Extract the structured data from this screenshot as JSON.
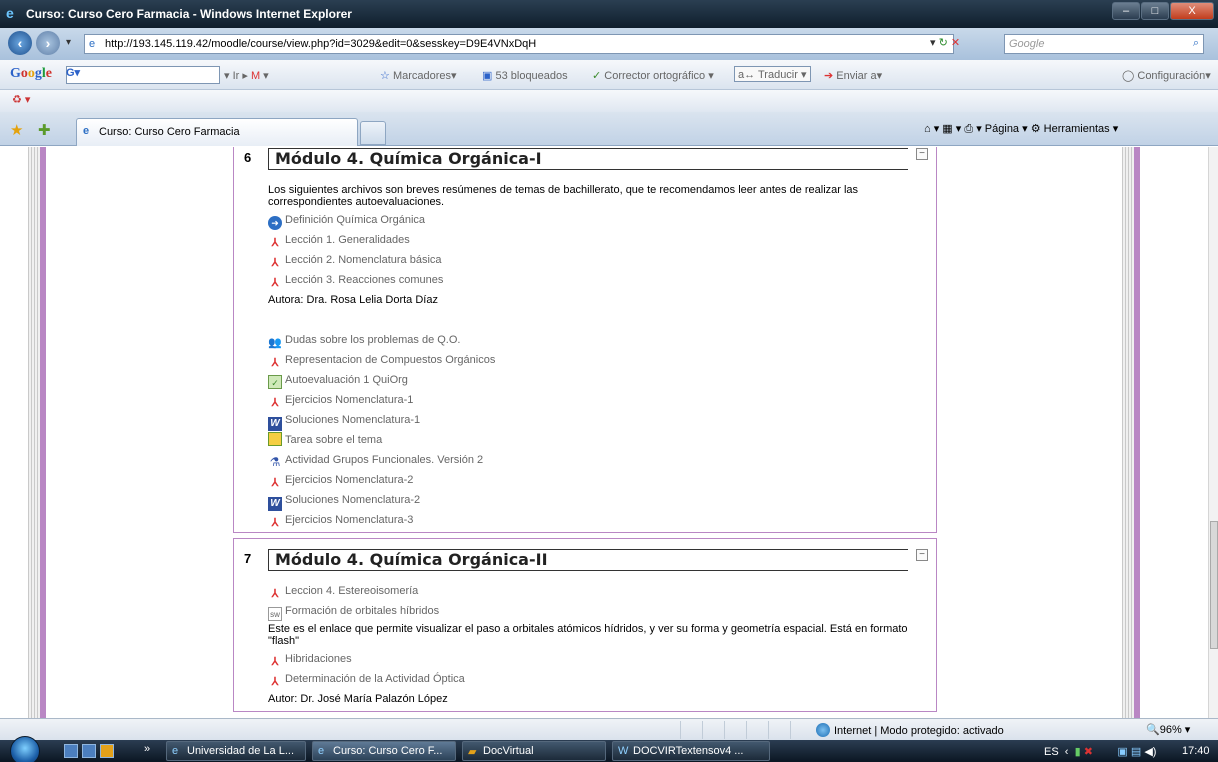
{
  "window": {
    "title": "Curso: Curso Cero Farmacia - Windows Internet Explorer",
    "controls": [
      "–",
      "□",
      "X"
    ]
  },
  "address": {
    "url": "http://193.145.119.42/moodle/course/view.php?id=3029&edit=0&sesskey=D9E4VNxDqH",
    "search_placeholder": "Google"
  },
  "google_toolbar": {
    "logo": [
      "G",
      "o",
      "o",
      "g",
      "l",
      "e"
    ],
    "search_prefix": "G▾",
    "go_label": "Ir",
    "bookmarks": "Marcadores▾",
    "blocked": "53 bloqueados",
    "spellcheck": "Corrector ortográfico ▾",
    "translate": "Traducir",
    "send": "Enviar a▾",
    "settings": "Configuración▾"
  },
  "tabs": {
    "active_tab": "Curso: Curso Cero Farmacia",
    "command_bar": "▾  ▾  ▾ Página ▾  Herramientas ▾",
    "page_label": "Página ▾",
    "tools_label": "Herramientas ▾"
  },
  "section6": {
    "number": "6",
    "title": "Módulo 4. Química Orgánica-I",
    "collapse": "−",
    "intro": "Los siguientes archivos son breves resúmenes de temas de bachillerato, que te recomendamos leer antes de realizar las correspondientes autoevaluaciones.",
    "items": [
      {
        "icon": "link",
        "label": "Definición Química Orgánica"
      },
      {
        "icon": "pdf",
        "label": "Lección 1. Generalidades"
      },
      {
        "icon": "pdf",
        "label": "Lección 2. Nomenclatura básica"
      },
      {
        "icon": "pdf",
        "label": "Lección 3. Reacciones comunes"
      }
    ],
    "author": "Autora: Dra. Rosa Lelia Dorta Díaz",
    "items2": [
      {
        "icon": "forum",
        "label": "Dudas sobre los problemas de Q.O."
      },
      {
        "icon": "pdf",
        "label": "Representacion de Compuestos Orgánicos"
      },
      {
        "icon": "quiz",
        "label": "Autoevaluación 1 QuiOrg"
      },
      {
        "icon": "pdf",
        "label": "Ejercicios Nomenclatura-1"
      },
      {
        "icon": "word",
        "label": "Soluciones Nomenclatura-1"
      },
      {
        "icon": "task",
        "label": "Tarea sobre el tema"
      },
      {
        "icon": "hotpot",
        "label": "Actividad Grupos Funcionales. Versión 2"
      },
      {
        "icon": "pdf",
        "label": "Ejercicios Nomenclatura-2"
      },
      {
        "icon": "word",
        "label": "Soluciones Nomenclatura-2"
      },
      {
        "icon": "pdf",
        "label": "Ejercicios Nomenclatura-3"
      }
    ]
  },
  "section7": {
    "number": "7",
    "title": "Módulo 4. Química Orgánica-II",
    "collapse": "−",
    "items": [
      {
        "icon": "pdf",
        "label": "Leccion 4. Estereoisomería"
      },
      {
        "icon": "flash",
        "label": "Formación de orbitales híbridos"
      }
    ],
    "desc": "Este es el enlace que permite visualizar el paso a orbitales atómicos hídridos, y ver su forma y geometría espacial. Está en formato \"flash\"",
    "items2": [
      {
        "icon": "pdf",
        "label": "Hibridaciones"
      },
      {
        "icon": "pdf",
        "label": "Determinación de la Actividad Óptica"
      }
    ],
    "author": "Autor: Dr. José María Palazón López"
  },
  "status": {
    "zone": "Internet | Modo protegido: activado",
    "zoom": "96%"
  },
  "taskbar": {
    "buttons": [
      "Universidad de La L...",
      "Curso: Curso Cero F...",
      "DocVirtual",
      "DOCVIRTextensov4 ..."
    ],
    "lang": "ES",
    "time": "17:40"
  },
  "colors": {
    "accent_purple": "#b987c4",
    "pdf_red": "#dd3333",
    "link_blue": "#2d6fc4"
  }
}
